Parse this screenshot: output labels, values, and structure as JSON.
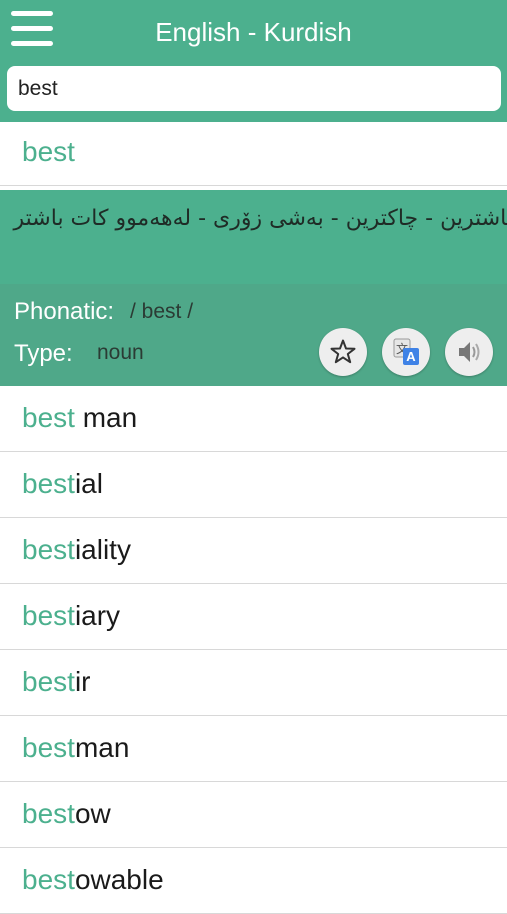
{
  "header": {
    "title": "English - Kurdish"
  },
  "search": {
    "value": "best"
  },
  "entry": {
    "word": "best",
    "translation": "باشترین - چاکترین - بەشی زۆری - لەهەموو کات باشتر",
    "phonetic_label": "Phonatic:",
    "phonetic_value": "/ best /",
    "type_label": "Type:",
    "type_value": "noun"
  },
  "actions": {
    "favorite_icon": "star-icon",
    "translate_icon": "google-translate-icon",
    "speak_icon": "speaker-icon"
  },
  "suggestions": [
    {
      "match": "best",
      "rest": " man"
    },
    {
      "match": "best",
      "rest": "ial"
    },
    {
      "match": "best",
      "rest": "iality"
    },
    {
      "match": "best",
      "rest": "iary"
    },
    {
      "match": "best",
      "rest": "ir"
    },
    {
      "match": "best",
      "rest": "man"
    },
    {
      "match": "best",
      "rest": "ow"
    },
    {
      "match": "best",
      "rest": "owable"
    }
  ],
  "colors": {
    "accent": "#4cb08e",
    "info_panel": "#4fa889",
    "button_bg": "#eeeeee"
  }
}
